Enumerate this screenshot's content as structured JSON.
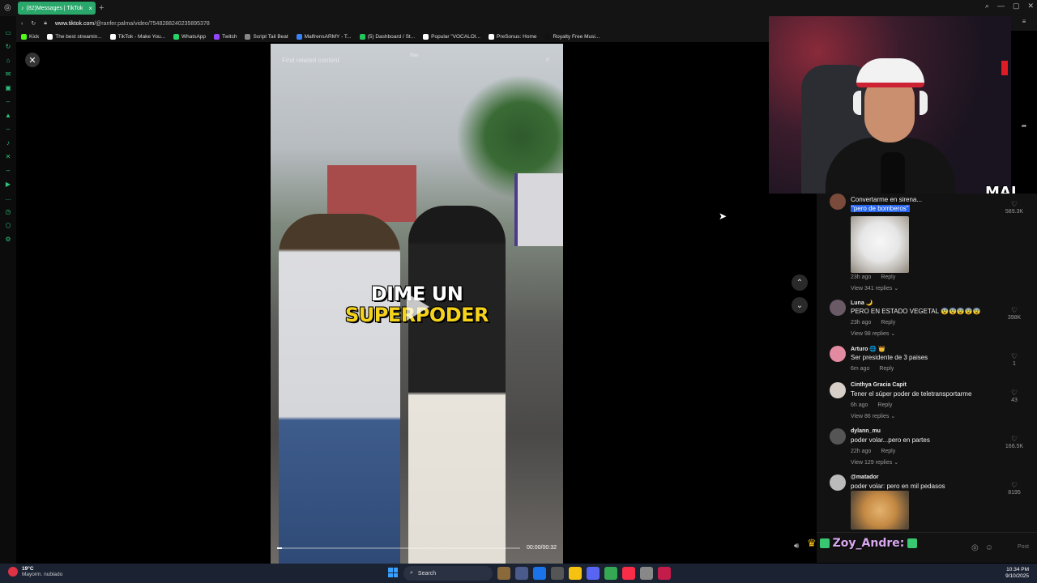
{
  "browser": {
    "tab_title": "(82)Messages | TikTok",
    "url_host": "www.tiktok.com",
    "url_path": "/@ranfer.palma/video/7548288240235895378"
  },
  "bookmarks": [
    {
      "label": "Kick",
      "color": "#53fc18"
    },
    {
      "label": "The best streamin...",
      "color": "#ffffff"
    },
    {
      "label": "TikTok - Make You...",
      "color": "#ffffff"
    },
    {
      "label": "WhatsApp",
      "color": "#25d366"
    },
    {
      "label": "Twitch",
      "color": "#9146ff"
    },
    {
      "label": "Script Tail Beat",
      "color": "#888888"
    },
    {
      "label": "MalfrensARMY - T...",
      "color": "#3b82f6"
    },
    {
      "label": "(5) Dashboard / St...",
      "color": "#22c55e"
    },
    {
      "label": "Popular \"VOCALOI...",
      "color": "#ffffff"
    },
    {
      "label": "PreSonus: Home",
      "color": "#ffffff"
    },
    {
      "label": "Royalty Free Musi...",
      "color": "#111111"
    }
  ],
  "video": {
    "overlay_top": "Find related content",
    "overlay_center": "Rex",
    "caption_line1": "DIME UN",
    "caption_line2": "SUPERPODER",
    "time": "00:00/00:32",
    "progress": 0.02
  },
  "overlay": {
    "streamer_tag": "MAI",
    "chat_user": "Zoy_Andre:"
  },
  "comments": [
    {
      "user": "",
      "text": "Convertarme en sirena...",
      "text2": "\"pero de bomberos\"",
      "likes": "589.3K",
      "time": "23h ago",
      "reply": "Reply",
      "replies": "View 341 replies",
      "avatar": "#7a4a3a"
    },
    {
      "user": "Luna 🌙",
      "text": "PERO EN ESTADO VEGETAL 😨😨😨😨😨",
      "likes": "398K",
      "time": "23h ago",
      "reply": "Reply",
      "replies": "View 98 replies",
      "avatar": "#6a5a66"
    },
    {
      "user": "Arturo 🌐 👑",
      "text": "Ser presidente de 3 paises",
      "likes": "1",
      "time": "6m ago",
      "reply": "Reply",
      "replies": "",
      "avatar": "#e28aa0"
    },
    {
      "user": "Cinthya Gracia Capit",
      "text": "Tener el súper poder de teletransportarme",
      "likes": "43",
      "time": "6h ago",
      "reply": "Reply",
      "replies": "View 86 replies",
      "avatar": "#d8d0c8"
    },
    {
      "user": "dylann_mu",
      "text": "poder volar...pero en partes",
      "likes": "166.5K",
      "time": "22h ago",
      "reply": "Reply",
      "replies": "View 129 replies",
      "avatar": "#555555"
    },
    {
      "user": "@matador",
      "text": "poder volar: pero en mil pedasos",
      "likes": "8195",
      "time": "",
      "reply": "",
      "replies": "",
      "avatar": "#bbbbbb"
    }
  ],
  "input": {
    "post": "Post"
  },
  "taskbar": {
    "temp": "19°C",
    "weather": "Mayorm. nublado",
    "search": "Search",
    "time": "10:34 PM",
    "date": "9/10/2025"
  }
}
